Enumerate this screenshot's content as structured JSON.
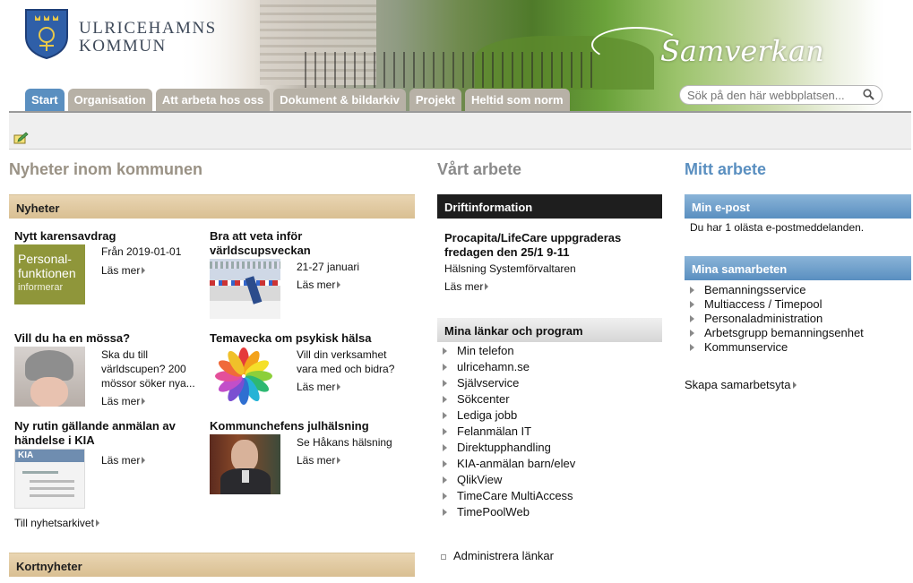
{
  "header": {
    "brand_line1": "ULRICEHAMNS",
    "brand_line2": "KOMMUN",
    "banner_text": "Samverkan",
    "tabs": [
      {
        "label": "Start"
      },
      {
        "label": "Organisation"
      },
      {
        "label": "Att arbeta hos oss"
      },
      {
        "label": "Dokument & bildarkiv"
      },
      {
        "label": "Projekt"
      },
      {
        "label": "Heltid som norm"
      }
    ],
    "search_placeholder": "Sök på den här webbplatsen..."
  },
  "left": {
    "title": "Nyheter inom kommunen",
    "news_header": "Nyheter",
    "items": [
      {
        "title": "Nytt karensavdrag",
        "text": "Från 2019-01-01",
        "more": "Läs mer",
        "thumb_line1": "Personal-",
        "thumb_line2": "funktionen",
        "thumb_line3": "informerar"
      },
      {
        "title": "Bra att veta inför världscupsveckan",
        "text": "21-27 januari",
        "more": "Läs mer"
      },
      {
        "title": "Vill du ha en mössa?",
        "text": "Ska du till världscupen? 200 mössor söker nya...",
        "more": "Läs mer"
      },
      {
        "title": "Temavecka om psykisk hälsa",
        "text": "Vill din verksamhet vara med och bidra?",
        "more": "Läs mer"
      },
      {
        "title": "Ny rutin gällande anmälan av händelse i KIA",
        "text": "",
        "more": "Läs mer",
        "thumb_label": "KIA"
      },
      {
        "title": "Kommunchefens julhälsning",
        "text": "Se Håkans hälsning",
        "more": "Läs mer"
      }
    ],
    "archive_link": "Till nyhetsarkivet",
    "short_news_header": "Kortnyheter"
  },
  "middle": {
    "title": "Vårt arbete",
    "drift_header": "Driftinformation",
    "drift_title": "Procapita/LifeCare uppgraderas fredagen den 25/1 9-11",
    "drift_text": "Hälsning Systemförvaltaren",
    "drift_more": "Läs mer",
    "links_header": "Mina länkar och program",
    "links": [
      "Min telefon",
      "ulricehamn.se",
      "Självservice",
      "Sökcenter",
      "Lediga jobb",
      "Felanmälan IT",
      "Direktupphandling",
      "KIA-anmälan barn/elev",
      "QlikView",
      "TimeCare MultiAccess",
      "TimePoolWeb"
    ],
    "admin_links": "Administrera länkar"
  },
  "right": {
    "title": "Mitt arbete",
    "email_header": "Min e-post",
    "email_text": "Du har 1 olästa e-postmeddelanden.",
    "collab_header": "Mina samarbeten",
    "collabs": [
      "Bemanningsservice",
      "Multiaccess / Timepool",
      "Personaladministration",
      "Arbetsgrupp bemanningsenhet",
      "Kommunservice"
    ],
    "create_link": "Skapa samarbetsyta"
  }
}
